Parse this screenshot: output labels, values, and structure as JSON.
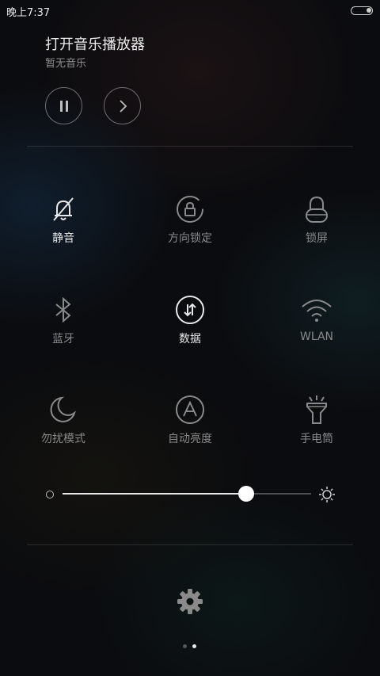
{
  "status_bar": {
    "time": "晚上7:37",
    "battery_icon": "battery-icon"
  },
  "music": {
    "title": "打开音乐播放器",
    "subtitle": "暂无音乐",
    "pause_icon": "pause-icon",
    "next_icon": "chevron-right-icon"
  },
  "toggles": [
    {
      "label": "静音",
      "icon": "bell-muted-icon",
      "active": true
    },
    {
      "label": "方向锁定",
      "icon": "rotation-lock-icon",
      "active": false
    },
    {
      "label": "锁屏",
      "icon": "lock-icon",
      "active": false
    },
    {
      "label": "蓝牙",
      "icon": "bluetooth-icon",
      "active": false
    },
    {
      "label": "数据",
      "icon": "mobile-data-icon",
      "active": true
    },
    {
      "label": "WLAN",
      "icon": "wifi-icon",
      "active": false
    },
    {
      "label": "勿扰模式",
      "icon": "moon-icon",
      "active": false
    },
    {
      "label": "自动亮度",
      "icon": "auto-brightness-icon",
      "active": false
    },
    {
      "label": "手电筒",
      "icon": "flashlight-icon",
      "active": false
    }
  ],
  "brightness": {
    "level": 0.74
  },
  "pager": {
    "pages": 2,
    "current": 2
  },
  "colors": {
    "active": "#e8e8e8",
    "inactive": "#8a8a8a",
    "background": "#0b0c0f"
  }
}
